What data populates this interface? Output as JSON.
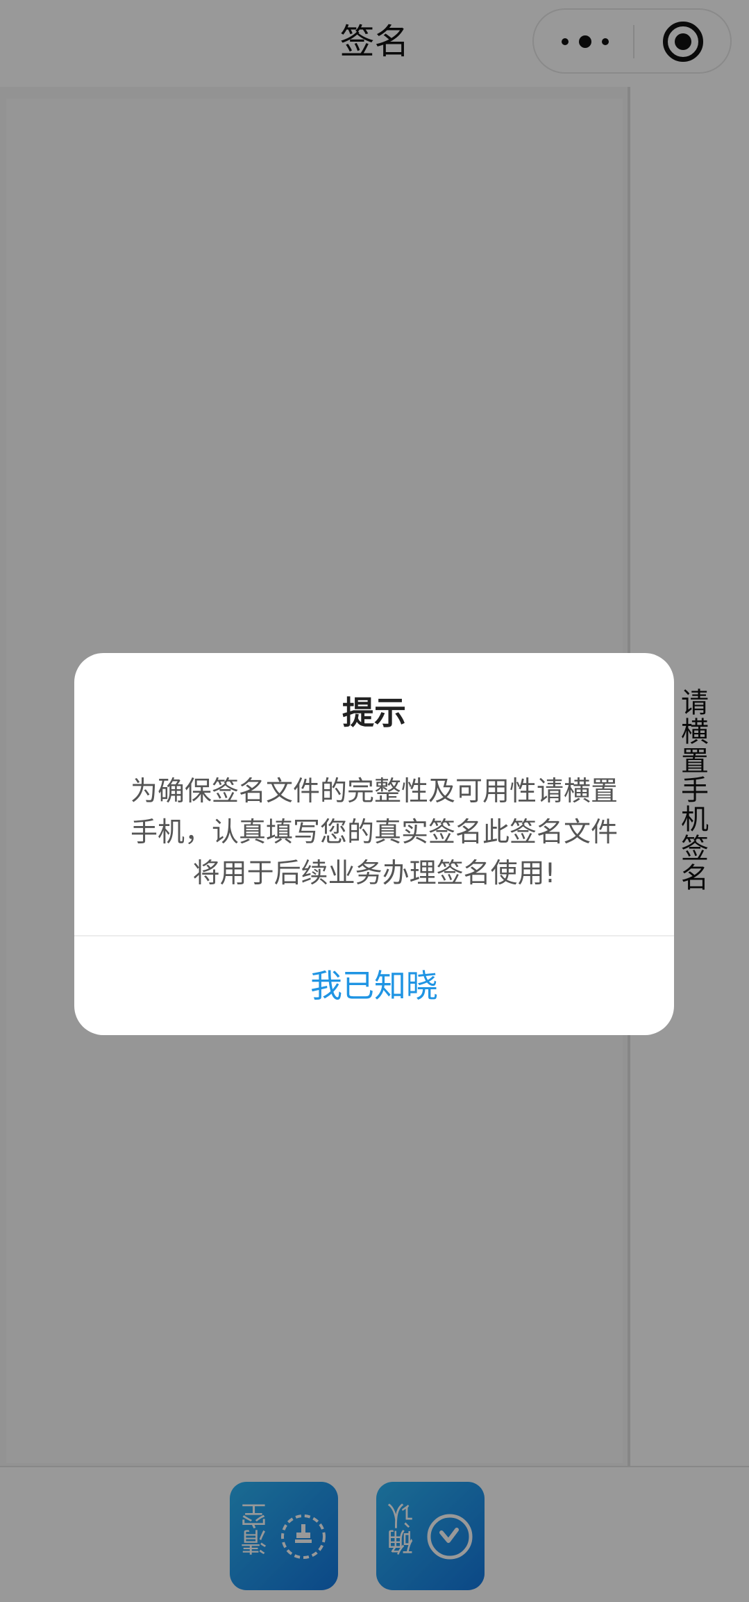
{
  "navbar": {
    "title": "签名",
    "more_icon": "more-dots-icon",
    "close_icon": "target-circle-icon"
  },
  "sign_area": {
    "side_hint": "请横置手机签名"
  },
  "actions": {
    "clear_label": "清空",
    "clear_icon": "reset-icon",
    "confirm_label": "确认",
    "confirm_icon": "check-circle-icon"
  },
  "dialog": {
    "title": "提示",
    "content": "为确保签名文件的完整性及可用性请横置手机，认真填写您的真实签名此签名文件将用于后续业务办理签名使用!",
    "button_label": "我已知晓"
  },
  "colors": {
    "accent": "#1f94e3",
    "button_gradient_start": "#2db3f4",
    "button_gradient_end": "#1478e0",
    "mask": "rgba(0,0,0,0.40)"
  }
}
